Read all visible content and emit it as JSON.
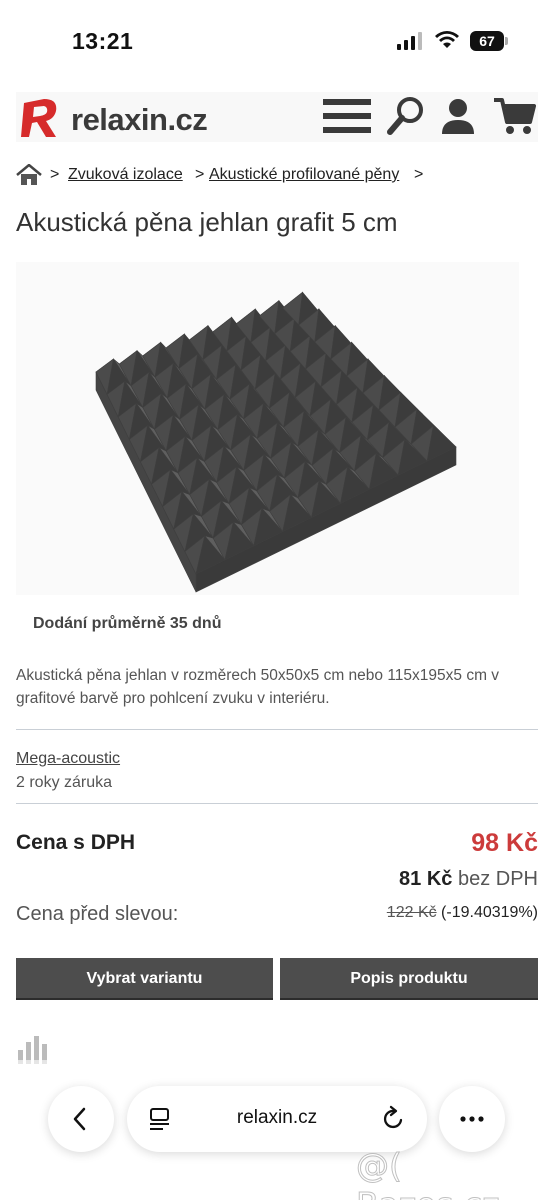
{
  "status_bar": {
    "time": "13:21",
    "battery": "67"
  },
  "header": {
    "logo_text": "relaxin.cz"
  },
  "breadcrumb": {
    "separator": ">",
    "items": [
      "Zvuková izolace",
      "Akustické profilované pěny"
    ]
  },
  "product": {
    "title": "Akustická pěna jehlan grafit 5 cm",
    "delivery": "Dodání průměrně 35 dnů",
    "description": "Akustická pěna jehlan v rozměrech 50x50x5 cm nebo 115x195x5 cm v grafitové barvě pro pohlcení zvuku v interiéru.",
    "brand": "Mega-acoustic",
    "warranty": "2 roky záruka"
  },
  "pricing": {
    "label": "Cena s DPH",
    "price": "98 Kč",
    "net_price": "81 Kč",
    "net_suffix": " bez DPH",
    "old_label": "Cena před slevou:",
    "old_price": "122 Kč",
    "discount": " (-19.40319%)"
  },
  "buttons": {
    "variant": "Vybrat variantu",
    "description": "Popis produktu"
  },
  "browser": {
    "address": "relaxin.cz"
  },
  "watermark": "@( Bazos.cz",
  "colors": {
    "price_red": "#cc3b3b",
    "button_bg": "#4d4d4d",
    "logo_red": "#d62b2b"
  }
}
